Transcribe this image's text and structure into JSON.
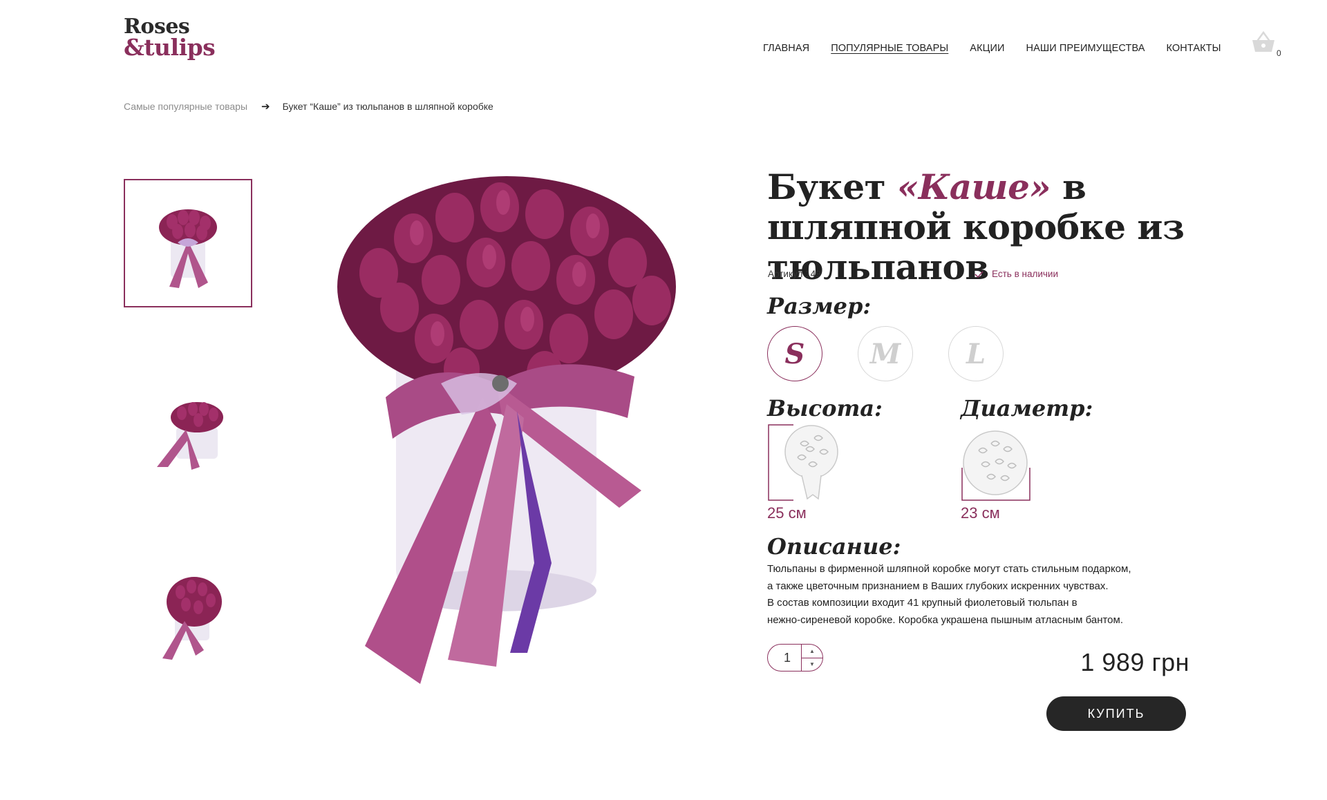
{
  "brand": {
    "line1": "Roses",
    "line2": "&tulips"
  },
  "nav": [
    {
      "label": "ГЛАВНАЯ",
      "active": false
    },
    {
      "label": "ПОПУЛЯРНЫЕ ТОВАРЫ",
      "active": true
    },
    {
      "label": "АКЦИИ",
      "active": false
    },
    {
      "label": "НАШИ ПРЕИМУЩЕСТВА",
      "active": false
    },
    {
      "label": "КОНТАКТЫ",
      "active": false
    }
  ],
  "cart": {
    "count": "0",
    "icon": "basket-icon"
  },
  "breadcrumb": {
    "parent": "Самые популярные товары",
    "current": "Букет “Каше” из тюльпанов в шляпной коробке"
  },
  "product": {
    "title_before": "Букет ",
    "title_accent": "«Каше»",
    "title_after": " в шляпной коробке из тюльпанов",
    "sku": "Артикул 149",
    "stock": "Есть в наличии",
    "size_label": "Размер:",
    "sizes": [
      "S",
      "M",
      "L"
    ],
    "selected_size": "S",
    "height_label": "Высота:",
    "height_value": "25 см",
    "diameter_label": "Диаметр:",
    "diameter_value": "23 см",
    "description_label": "Описание:",
    "description": [
      "Тюльпаны в фирменной шляпной коробке могут стать стильным подарком,",
      "а также цветочным признанием в Ваших глубоких искренних чувствах.",
      "В состав композиции входит 41 крупный фиолетовый тюльпан в",
      "нежно-сиреневой коробке. Коробка украшена пышным атласным бантом."
    ],
    "quantity": "1",
    "price": "1 989 грн",
    "buy_label": "КУПИТЬ"
  },
  "colors": {
    "accent": "#8a2f5c",
    "dark": "#262626",
    "muted": "#8c8c8c",
    "circle_border": "#d8d8d8"
  },
  "gallery": {
    "thumbnail_count": 3,
    "selected_thumbnail": 1
  }
}
